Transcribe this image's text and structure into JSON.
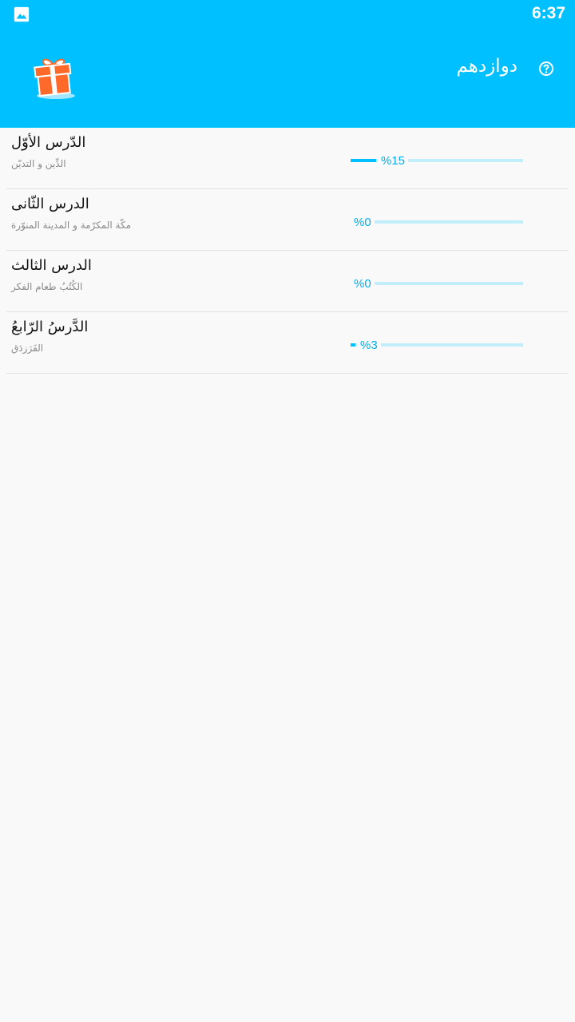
{
  "status_bar": {
    "time": "6:37",
    "left_icon": "image-icon"
  },
  "app_bar": {
    "title": "دوازدهم",
    "gift_icon": "gift-icon",
    "help_icon": "help-icon"
  },
  "colors": {
    "accent": "#00c0ff",
    "track": "#c2eefc",
    "background": "#f9f9f9"
  },
  "lessons": [
    {
      "title": "الدّرس الأوّل",
      "subtitle": "الدِّين و التديّن",
      "progress_label": "%15",
      "progress": 0.15
    },
    {
      "title": "الدرس الثّانی",
      "subtitle": "مكّة المكرّمة و المدينة المنوّرة",
      "progress_label": "%0",
      "progress": 0
    },
    {
      "title": "الدرس الثالث",
      "subtitle": "الكُتُبُ طعام الفکر",
      "progress_label": "%0",
      "progress": 0
    },
    {
      "title": "الدَّرسُ الرّابعُ",
      "subtitle": "الفَرَزدَق",
      "progress_label": "%3",
      "progress": 0.03
    }
  ]
}
